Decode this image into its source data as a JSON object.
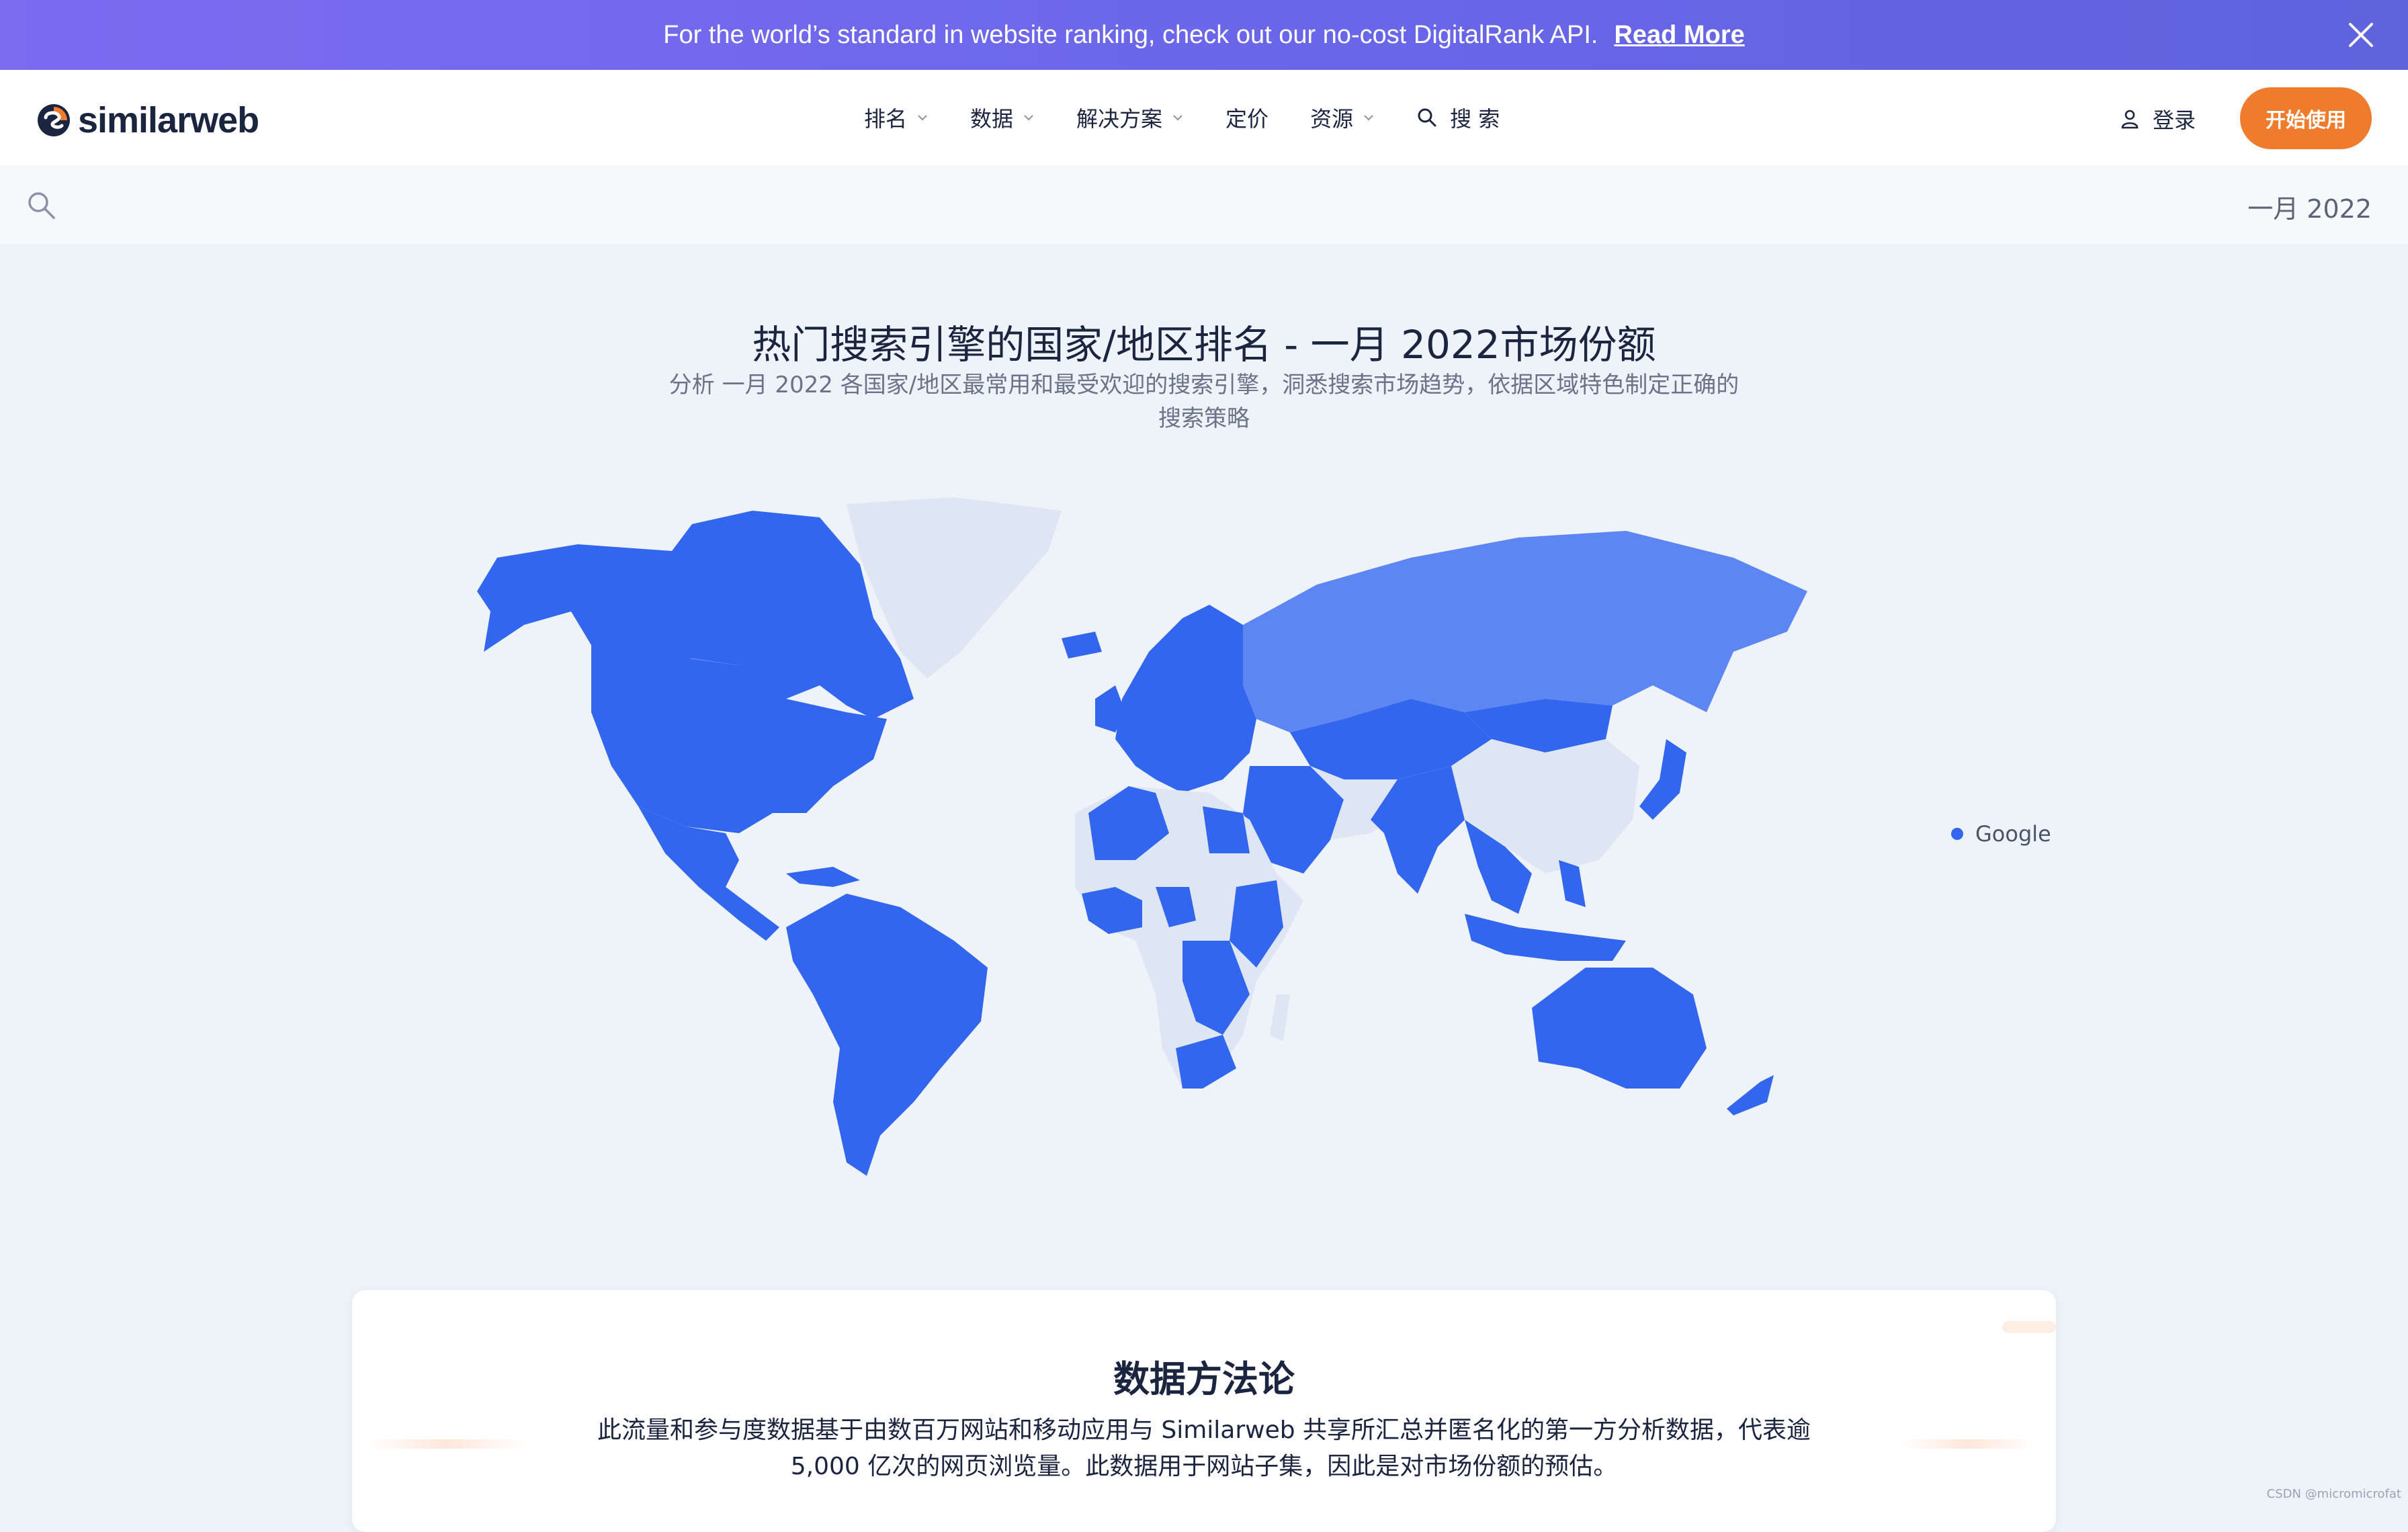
{
  "banner": {
    "message": "For the world’s standard in website ranking, check out our no-cost DigitalRank API.",
    "link": "Read More"
  },
  "header": {
    "logo": "similarweb",
    "nav": [
      {
        "label": "排名"
      },
      {
        "label": "数据"
      },
      {
        "label": "解决方案"
      },
      {
        "label": "定价"
      },
      {
        "label": "资源"
      }
    ],
    "search_label": "搜 索",
    "login_label": "登录",
    "cta_label": "开始使用"
  },
  "subbar": {
    "period": "一月 2022"
  },
  "main": {
    "title": "热门搜索引擎的国家/地区排名 - 一月 2022市场份额",
    "subtitle": "分析 一月 2022 各国家/地区最常用和最受欢迎的搜索引擎，洞悉搜索市场趋势，依据区域特色制定正确的搜索策略"
  },
  "legend": {
    "label": "Google",
    "color": "#3366ee"
  },
  "colors": {
    "accent": "#ef7b2d",
    "map_primary": "#3366ee",
    "map_alt": "#5d86f2",
    "map_none": "#dfe6f3"
  },
  "methodology": {
    "title": "数据方法论",
    "body": "此流量和参与度数据基于由数百万网站和移动应用与 Similarweb 共享所汇总并匿名化的第一方分析数据，代表逾 5,000 亿次的网页浏览量。此数据用于网站子集，因此是对市场份额的预估。"
  },
  "footer": {
    "watermark": "CSDN @micromicrofat"
  }
}
